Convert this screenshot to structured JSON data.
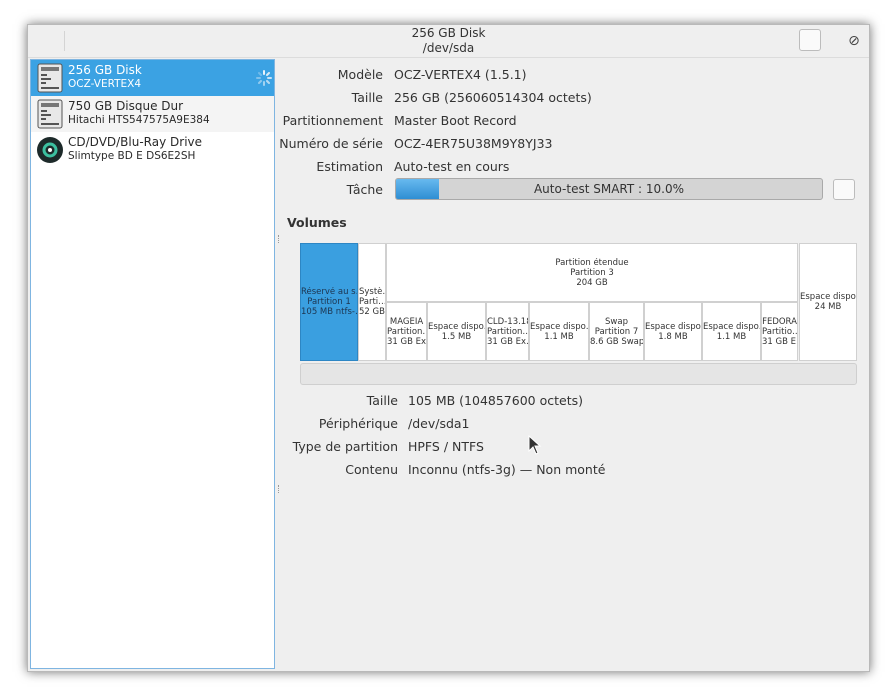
{
  "titlebar": {
    "title": "256 GB Disk",
    "subtitle": "/dev/sda",
    "close_glyph": "⊘"
  },
  "devices": [
    {
      "name": "256 GB Disk",
      "sub": "OCZ-VERTEX4",
      "icon": "hard-disk-icon",
      "selected": true,
      "busy": true
    },
    {
      "name": "750 GB Disque Dur",
      "sub": "Hitachi HTS547575A9E384",
      "icon": "hard-disk-icon",
      "selected": false
    },
    {
      "name": "CD/DVD/Blu-Ray Drive",
      "sub": "Slimtype BD  E  DS6E2SH",
      "icon": "optical-drive-icon",
      "selected": false
    }
  ],
  "details": [
    {
      "label": "Modèle",
      "value": "OCZ-VERTEX4 (1.5.1)"
    },
    {
      "label": "Taille",
      "value": "256 GB (256060514304 octets)"
    },
    {
      "label": "Partitionnement",
      "value": "Master Boot Record"
    },
    {
      "label": "Numéro de série",
      "value": "OCZ-4ER75U38M9Y8YJ33"
    },
    {
      "label": "Estimation",
      "value": "Auto-test en cours"
    },
    {
      "label": "Tâche",
      "value": ""
    }
  ],
  "task": {
    "text": "Auto-test SMART : 10.0%",
    "progress_pct": 10
  },
  "volumes_title": "Volumes",
  "volumes": {
    "part1": [
      "Réservé au s…",
      "Partition 1",
      "105 MB ntfs-…"
    ],
    "part2": [
      "Systè…",
      "Parti…",
      "52 GB…"
    ],
    "extended": [
      "Partition étendue",
      "Partition 3",
      "204 GB"
    ],
    "logical": [
      [
        "MAGEIA",
        "Partition…",
        "31 GB Ex…"
      ],
      [
        "Espace dispo…",
        "1.5 MB"
      ],
      [
        "CLD-13.18",
        "Partition…",
        "31 GB Ex…"
      ],
      [
        "Espace dispo…",
        "1.1 MB"
      ],
      [
        "Swap",
        "Partition 7",
        "8.6 GB Swap"
      ],
      [
        "Espace dispo…",
        "1.8 MB"
      ],
      [
        "Espace dispo…",
        "1.1 MB"
      ],
      [
        "FEDORA",
        "Partitio…",
        "31 GB E…"
      ]
    ],
    "free_end": [
      "Espace dispo…",
      "24 MB"
    ]
  },
  "volume_details": [
    {
      "label": "Taille",
      "value": "105 MB (104857600 octets)"
    },
    {
      "label": "Périphérique",
      "value": "/dev/sda1"
    },
    {
      "label": "Type de partition",
      "value": "HPFS / NTFS"
    },
    {
      "label": "Contenu",
      "value": "Inconnu (ntfs-3g) — Non monté"
    }
  ],
  "colors": {
    "accent": "#3ba2e3",
    "window_bg": "#efefef",
    "selected_segment": "#3a9fe0"
  }
}
